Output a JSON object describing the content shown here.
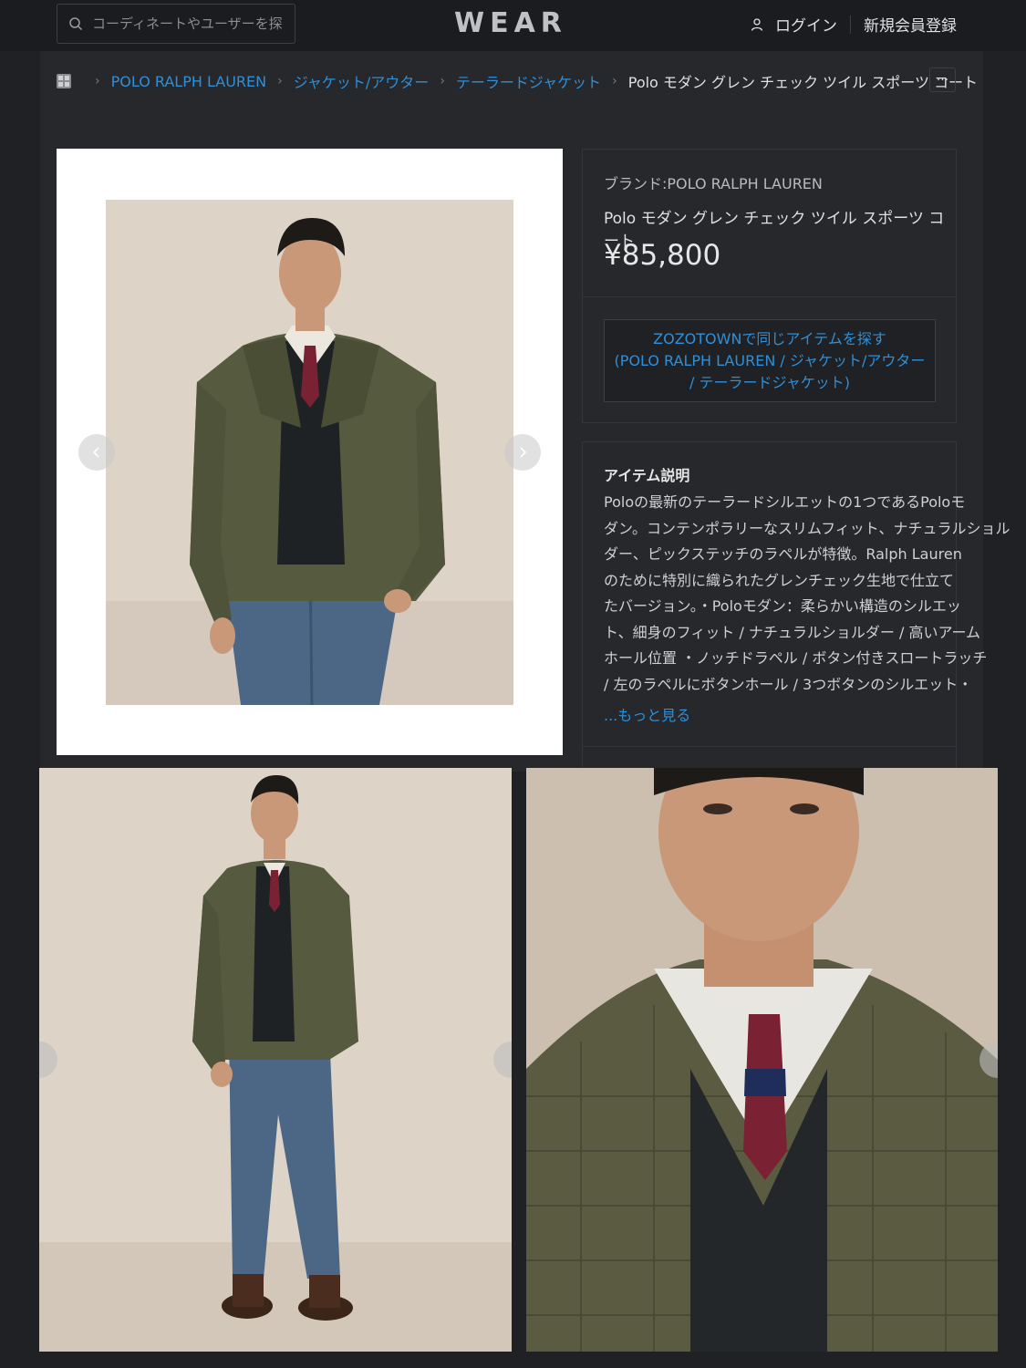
{
  "header": {
    "search_placeholder": "コーディネートやユーザーを探す",
    "logo": "WEAR",
    "login_label": "ログイン",
    "register_label": "新規会員登録"
  },
  "breadcrumb": {
    "items": [
      "POLO RALPH LAUREN",
      "ジャケット/アウター",
      "テーラードジャケット"
    ],
    "current": "Polo モダン グレン チェック ツイル スポーツ コート"
  },
  "more_button_label": "···",
  "product": {
    "brand": "ブランド:POLO RALPH LAUREN",
    "name": "Polo モダン グレン チェック ツイル スポーツ コート",
    "price": "¥85,800",
    "zozo_button_lines": [
      "ZOZOTOWNで同じアイテムを探す",
      "(POLO RALPH LAUREN / ジャケット/アウター",
      "/ テーラードジャケット)"
    ]
  },
  "description": {
    "title": "アイテム説明",
    "lines": [
      "Poloの最新のテーラードシルエットの1つであるPoloモ",
      "ダン。コンテンポラリーなスリムフィット、ナチュラルショル",
      "ダー、ピックステッチのラペルが特徴。Ralph Lauren",
      "のために特別に織られたグレンチェック生地で仕立て",
      "たバージョン。・Poloモダン：柔らかい構造のシルエッ",
      "ト、細身のフィット / ナチュラルショルダー / 高いアーム",
      "ホール位置 ・ノッチドラペル / ボタン付きスロートラッチ",
      "/ 左のラペルにボタンホール / 3つボタンのシルエット・"
    ],
    "more_link": "...もっと見る"
  },
  "colors": {
    "background": "#1f2124",
    "panel": "#26282c",
    "link": "#2f8fd8",
    "jacket": "#565a3f"
  }
}
